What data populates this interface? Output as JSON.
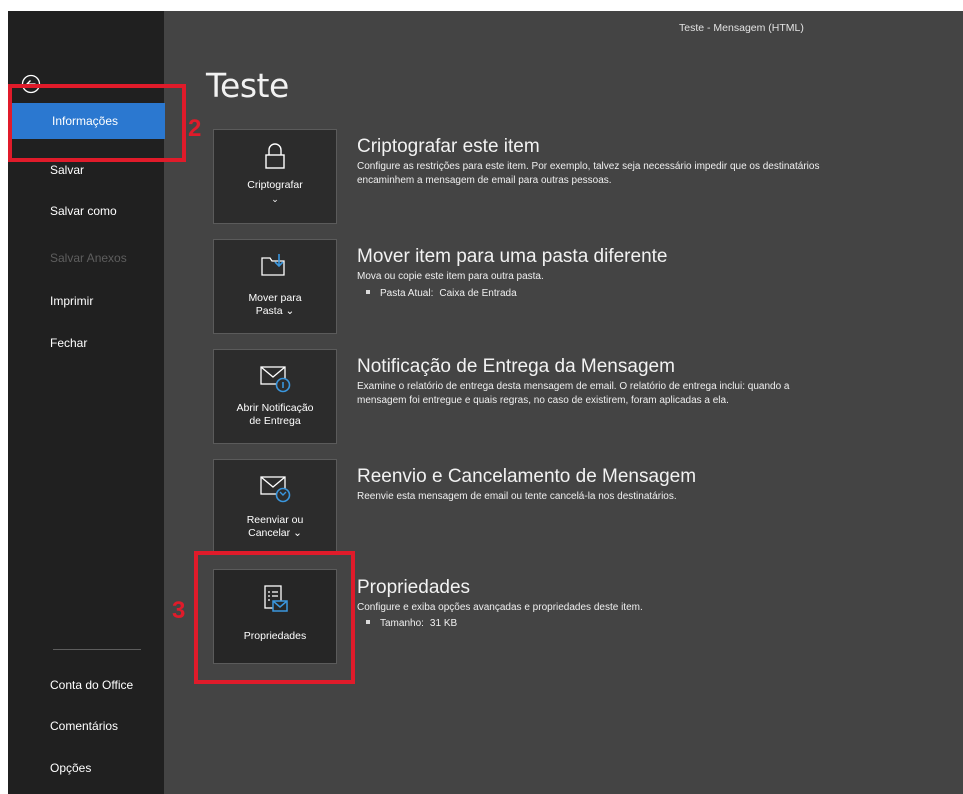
{
  "window": {
    "title": "Teste - Mensagem (HTML)"
  },
  "page": {
    "title": "Teste"
  },
  "sidebar": {
    "items": [
      {
        "label": "Informações"
      },
      {
        "label": "Salvar"
      },
      {
        "label": "Salvar como"
      },
      {
        "label": "Salvar Anexos"
      },
      {
        "label": "Imprimir"
      },
      {
        "label": "Fechar"
      }
    ],
    "bottom_items": [
      {
        "label": "Conta do Office"
      },
      {
        "label": "Comentários"
      },
      {
        "label": "Opções"
      }
    ]
  },
  "sections": [
    {
      "tile_label": "Criptografar",
      "tile_chevron": "⌄",
      "icon": "lock-icon",
      "title": "Criptografar este item",
      "description": "Configure as restrições para este item. Por exemplo, talvez seja necessário impedir que os destinatários encaminhem a mensagem de email para outras pessoas."
    },
    {
      "tile_label_1": "Mover para",
      "tile_label_2": "Pasta ⌄",
      "icon": "move-to-folder-icon",
      "title": "Mover item para uma pasta diferente",
      "description": "Mova ou copie este item para outra pasta.",
      "bullet_label": "Pasta Atual:",
      "bullet_value": "Caixa de Entrada"
    },
    {
      "tile_label_1": "Abrir Notificação",
      "tile_label_2": "de Entrega",
      "icon": "delivery-receipt-icon",
      "title": "Notificação de Entrega da Mensagem",
      "description": "Examine o relatório de entrega desta mensagem de email. O relatório de entrega inclui: quando a mensagem foi entregue e quais regras, no caso de existirem, foram aplicadas a ela."
    },
    {
      "tile_label_1": "Reenviar ou",
      "tile_label_2": "Cancelar ⌄",
      "icon": "resend-icon",
      "title": "Reenvio e Cancelamento de Mensagem",
      "description": "Reenvie esta mensagem de email ou tente cancelá-la nos destinatários."
    },
    {
      "tile_label": "Propriedades",
      "icon": "properties-icon",
      "title": "Propriedades",
      "description": "Configure e exiba opções avançadas e propriedades deste item.",
      "bullet_label": "Tamanho:",
      "bullet_value": "31 KB"
    }
  ],
  "annotations": {
    "marker_2": "2",
    "marker_3": "3"
  },
  "colors": {
    "sidebar_bg": "#202020",
    "content_bg": "#444444",
    "active_item": "#2b78d0",
    "tile_bg": "#2c2c2c",
    "annotation_red": "#e01b2a",
    "icon_accent": "#3a96dd"
  }
}
